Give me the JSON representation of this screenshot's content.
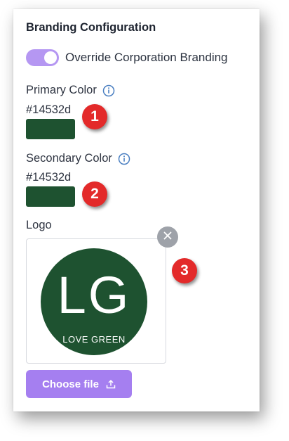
{
  "section": {
    "title": "Branding Configuration"
  },
  "override": {
    "label": "Override Corporation Branding",
    "enabled": true
  },
  "primary": {
    "label": "Primary Color",
    "hex": "#14532d",
    "swatch_color": "#1e5230"
  },
  "secondary": {
    "label": "Secondary Color",
    "hex": "#14532d",
    "swatch_color": "#1e5230"
  },
  "logo": {
    "label": "Logo",
    "image": {
      "mark": "LG",
      "text": "LOVE GREEN",
      "background": "#1e5230"
    },
    "remove_icon": "close-icon",
    "choose_label": "Choose file",
    "choose_icon": "upload-icon"
  },
  "callouts": [
    "1",
    "2",
    "3"
  ],
  "colors": {
    "accent": "#a57ff0",
    "toggle": "#b597f2",
    "info": "#4a7fc1",
    "callout": "#e32a2a"
  }
}
